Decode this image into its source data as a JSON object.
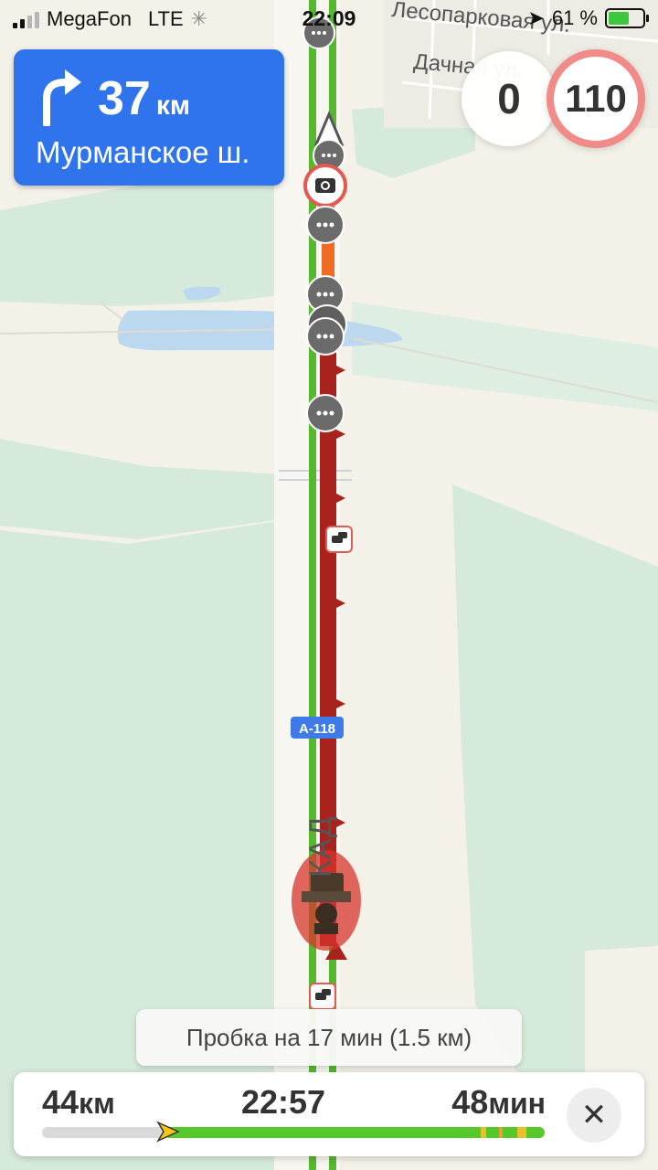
{
  "status_bar": {
    "carrier": "MegaFon",
    "network": "LTE",
    "time": "22:09",
    "battery": "61 %",
    "battery_level": 0.61
  },
  "map": {
    "street_labels": [
      "Лесопарковая ул.",
      "Дачная ул."
    ],
    "road_shield": "А-118",
    "road_name": "КАД",
    "colors": {
      "land": "#f3f1e8",
      "forest": "#d6eadb",
      "water": "#bcd8ee",
      "route_free": "#55b82e",
      "route_jam": "#a8221e",
      "route_slow": "#f06a24"
    }
  },
  "maneuver": {
    "distance": "37",
    "unit": "км",
    "street": "Мурманское ш.",
    "icon": "turn-right-arrow-icon"
  },
  "speed": {
    "current": "0",
    "limit": "110"
  },
  "traffic_tip": "Пробка на 17 мин (1.5 км)",
  "route_panel": {
    "distance_value": "44",
    "distance_unit": "км",
    "arrival": "22:57",
    "time_value": "48",
    "time_unit": "мин",
    "progress": 0.25,
    "close_icon": "close-icon"
  }
}
